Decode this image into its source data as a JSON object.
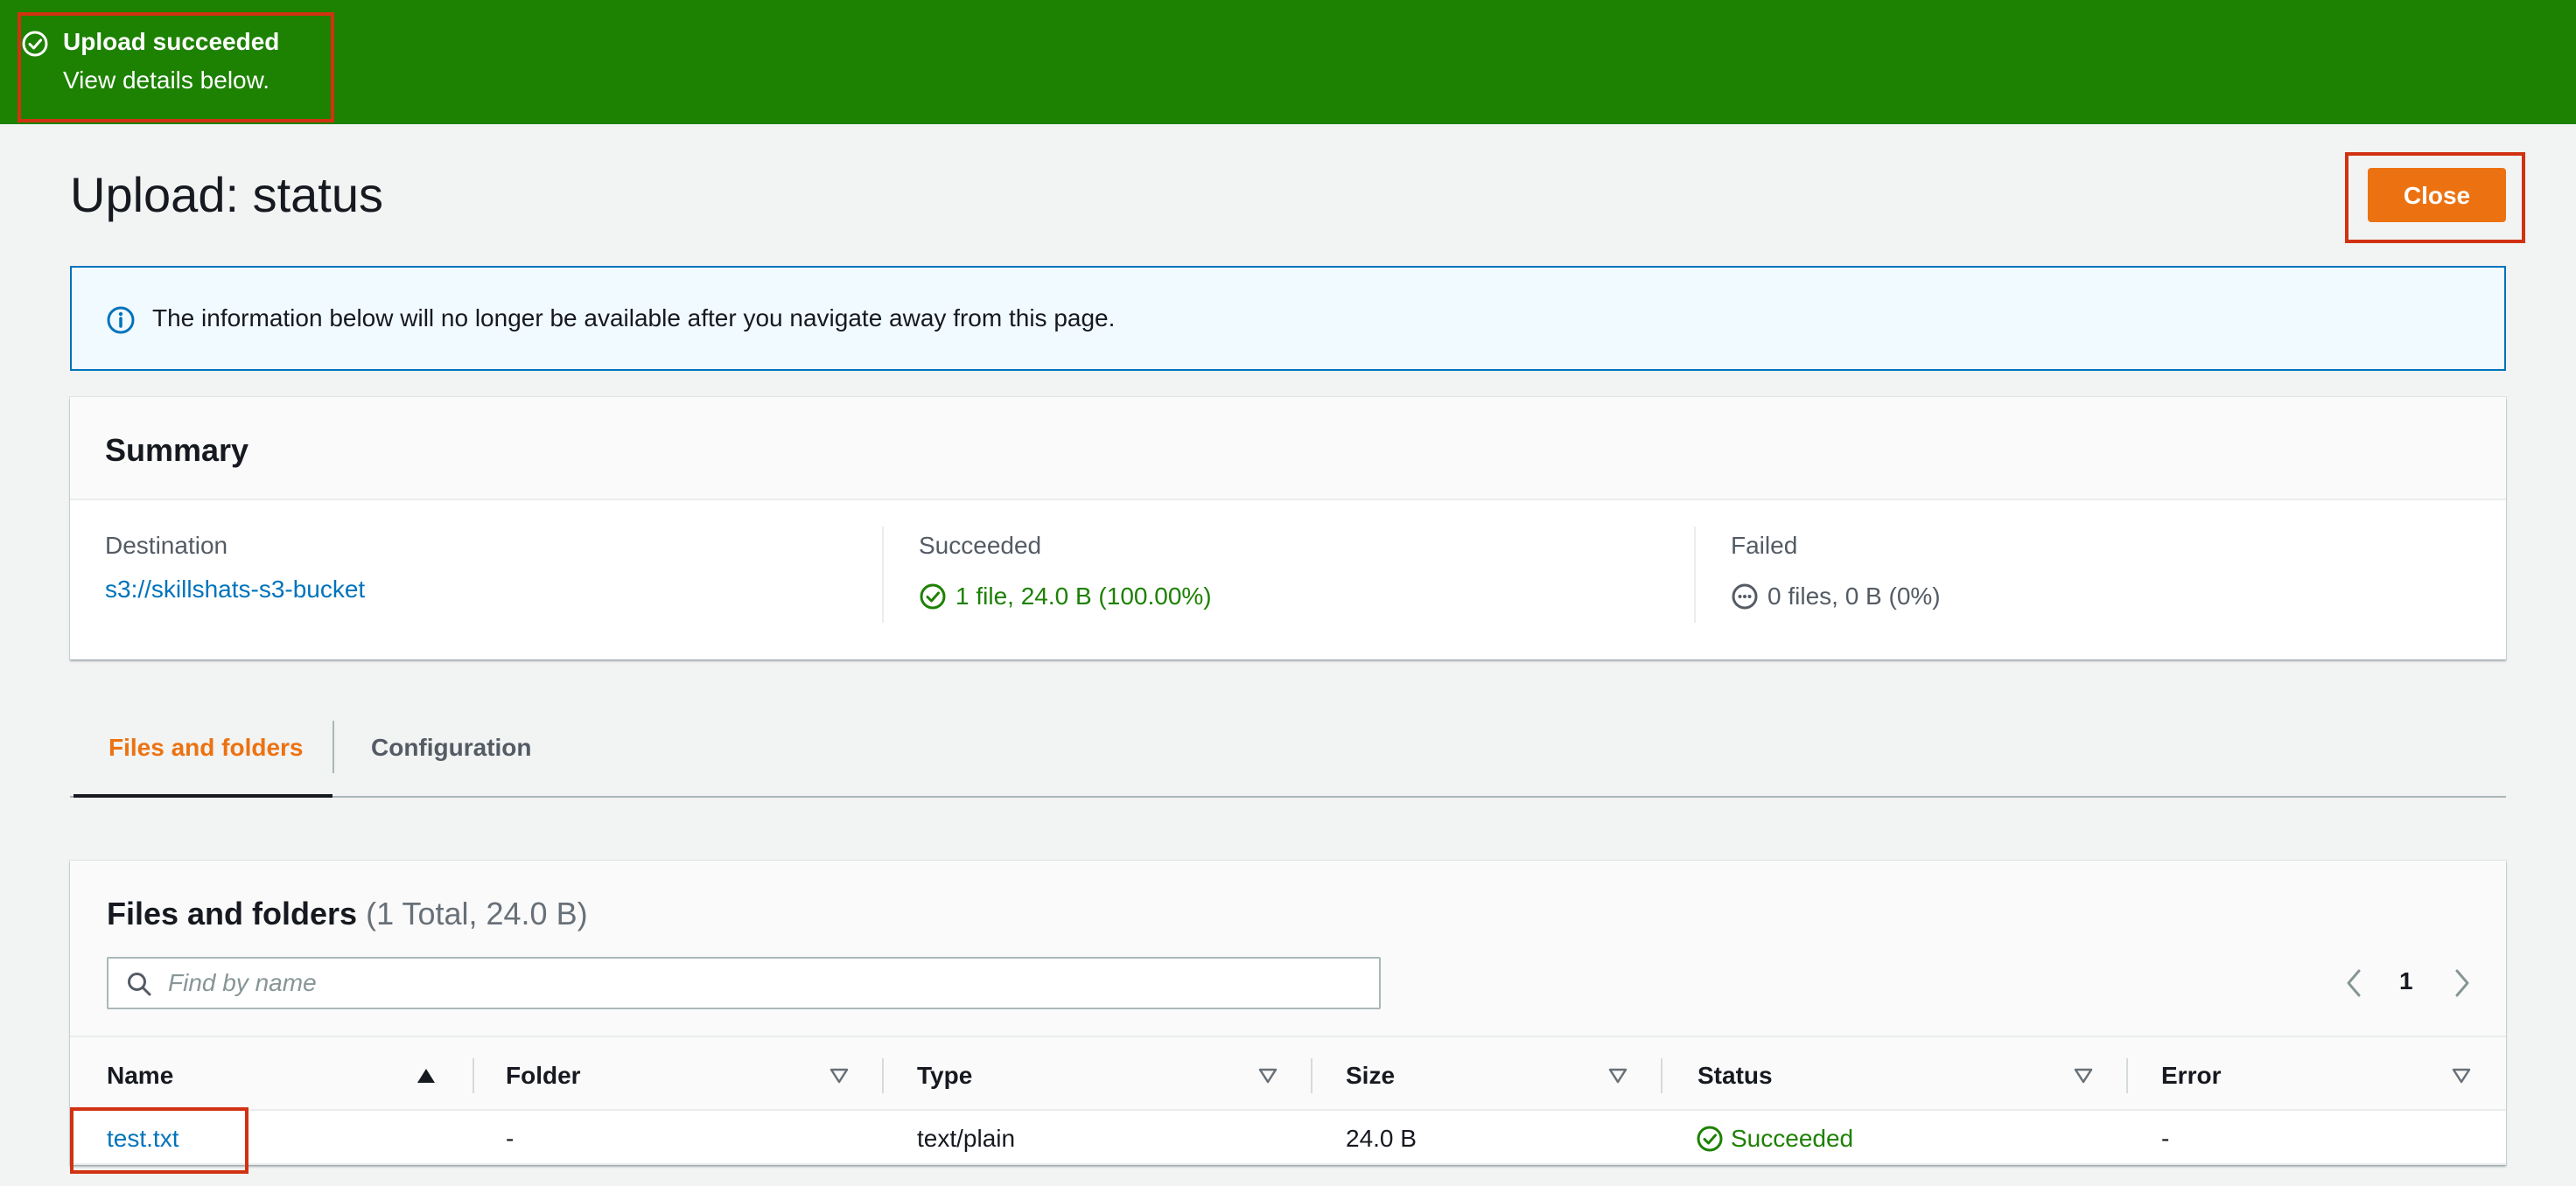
{
  "flash": {
    "icon": "check-circle-icon",
    "title": "Upload succeeded",
    "subtitle": "View details below."
  },
  "header": {
    "title": "Upload: status",
    "close_label": "Close"
  },
  "alert": {
    "icon": "info-icon",
    "text": "The information below will no longer be available after you navigate away from this page."
  },
  "summary": {
    "title": "Summary",
    "destination_label": "Destination",
    "destination_value": "s3://skillshats-s3-bucket",
    "succeeded_label": "Succeeded",
    "succeeded_value": "1 file, 24.0 B (100.00%)",
    "failed_label": "Failed",
    "failed_value": "0 files, 0 B (0%)"
  },
  "tabs": [
    {
      "label": "Files and folders",
      "active": true
    },
    {
      "label": "Configuration",
      "active": false
    }
  ],
  "files": {
    "title": "Files and folders",
    "count": "(1 Total, 24.0 B)",
    "search_placeholder": "Find by name",
    "page": "1",
    "columns": [
      "Name",
      "Folder",
      "Type",
      "Size",
      "Status",
      "Error"
    ],
    "rows": [
      {
        "name": "test.txt",
        "folder": "-",
        "type": "text/plain",
        "size": "24.0 B",
        "status": "Succeeded",
        "error": "-"
      }
    ]
  },
  "colors": {
    "success": "#1d8102",
    "primary_button": "#ec7211",
    "link": "#0073bb",
    "highlight_outline": "#d13212"
  }
}
